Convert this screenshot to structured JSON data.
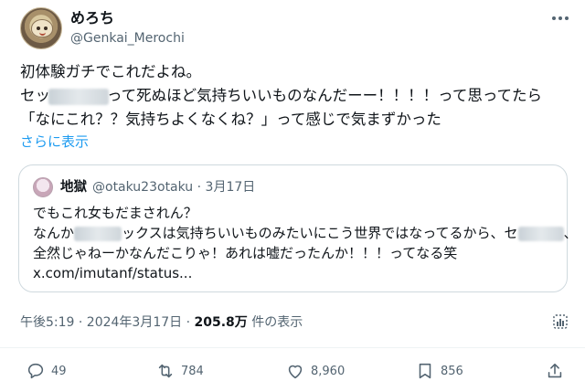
{
  "tweet": {
    "display_name": "めろち",
    "handle": "@Genkai_Merochi",
    "lines": [
      "初体験ガチでこれだよね。",
      "セッ",
      "って死ぬほど気持ちいいものなんだーー！！！！って思ってたら",
      "「なにこれ？？気持ちよくなくね？」って感じで気まずかった"
    ],
    "show_more": "さらに表示"
  },
  "quote": {
    "name": "地獄",
    "meta": "@otaku23otaku · 3月17日",
    "lines": [
      "でもこれ女もだまされん？",
      "なんか",
      "ックスは気持ちいいものみたいにこう世界ではなってるから、セ",
      "、",
      "全然じゃねーかなんだこりゃ！あれは嘘だったんか！！！ってなる笑",
      "x.com/imutanf/status..."
    ]
  },
  "meta": {
    "time_date": "午後5:19 · 2024年3月17日 · ",
    "views_count": "205.8万",
    "views_label": " 件の表示"
  },
  "actions": {
    "reply_count": "49",
    "retweet_count": "784",
    "like_count": "8,960",
    "bookmark_count": "856"
  },
  "icons": {
    "more": "more-dots-icon",
    "analytics": "analytics-icon",
    "reply": "reply-icon",
    "retweet": "retweet-icon",
    "like": "heart-icon",
    "bookmark": "bookmark-icon",
    "share": "share-icon"
  },
  "colors": {
    "accent": "#1d9bf0",
    "muted": "#536471",
    "text": "#0f1419",
    "border": "#cfd9de"
  }
}
